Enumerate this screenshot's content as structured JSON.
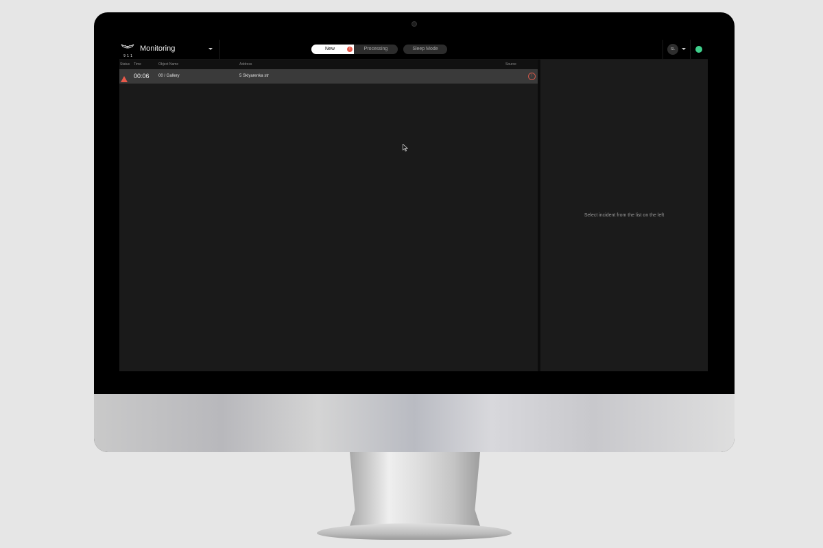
{
  "app": {
    "logo_text": "911",
    "title": "Monitoring"
  },
  "tabs": {
    "new_label": "New",
    "new_badge": "!",
    "processing_label": "Processing",
    "sleep_label": "Sleep Mode"
  },
  "user": {
    "initials": "SL",
    "status_color": "#3fd08c"
  },
  "table": {
    "columns": {
      "status": "Status",
      "time": "Time",
      "object": "Object Name",
      "address": "Address",
      "source": "Source"
    },
    "rows": [
      {
        "status_icon": "alarm-triangle-icon",
        "time": "00:06",
        "object": "00 / Gallery",
        "address": "5 Sklyarenka str",
        "source_icon": "alert-circle-icon",
        "source_glyph": "!"
      }
    ]
  },
  "detail": {
    "placeholder": "Select incident from the list on the left"
  },
  "colors": {
    "alarm": "#e8594a",
    "selected_tab": "#ffffff",
    "background": "#1a1a1a"
  }
}
